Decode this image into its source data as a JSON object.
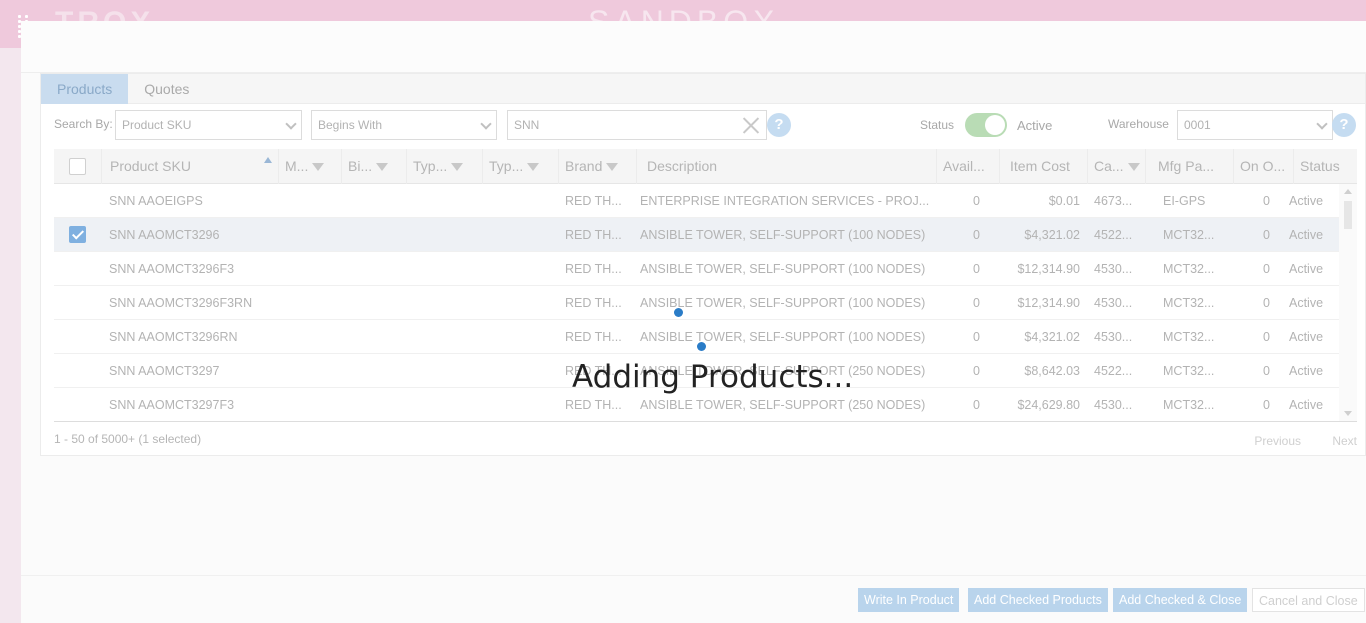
{
  "app": {
    "logo": "TROX",
    "environment": "SANDBOX"
  },
  "tabs": [
    {
      "label": "Products",
      "active": true
    },
    {
      "label": "Quotes",
      "active": false
    }
  ],
  "search": {
    "search_by_label": "Search By:",
    "search_by_value": "Product SKU",
    "match_value": "Begins With",
    "query": "SNN",
    "help": "?",
    "status_label": "Status",
    "status_value": "Active",
    "warehouse_label": "Warehouse",
    "warehouse_value": "0001"
  },
  "columns": [
    "Product SKU",
    "M...",
    "Bi...",
    "Typ...",
    "Typ...",
    "Brand",
    "Description",
    "Avail...",
    "Item Cost",
    "Ca...",
    "Mfg Pa...",
    "On O...",
    "Status"
  ],
  "rows": [
    {
      "sku": "SNN AAOEIGPS",
      "brand": "RED TH...",
      "description": "ENTERPRISE INTEGRATION SERVICES - PROJ...",
      "avail": "0",
      "cost": "$0.01",
      "cat": "4673...",
      "mfg": "EI-GPS",
      "on_order": "0",
      "status": "Active",
      "checked": false
    },
    {
      "sku": "SNN AAOMCT3296",
      "brand": "RED TH...",
      "description": "ANSIBLE TOWER, SELF-SUPPORT (100 NODES)",
      "avail": "0",
      "cost": "$4,321.02",
      "cat": "4522...",
      "mfg": "MCT32...",
      "on_order": "0",
      "status": "Active",
      "checked": true
    },
    {
      "sku": "SNN AAOMCT3296F3",
      "brand": "RED TH...",
      "description": "ANSIBLE TOWER, SELF-SUPPORT (100 NODES)",
      "avail": "0",
      "cost": "$12,314.90",
      "cat": "4530...",
      "mfg": "MCT32...",
      "on_order": "0",
      "status": "Active",
      "checked": false
    },
    {
      "sku": "SNN AAOMCT3296F3RN",
      "brand": "RED TH...",
      "description": "ANSIBLE TOWER, SELF-SUPPORT (100 NODES)",
      "avail": "0",
      "cost": "$12,314.90",
      "cat": "4530...",
      "mfg": "MCT32...",
      "on_order": "0",
      "status": "Active",
      "checked": false
    },
    {
      "sku": "SNN AAOMCT3296RN",
      "brand": "RED TH...",
      "description": "ANSIBLE TOWER, SELF-SUPPORT (100 NODES)",
      "avail": "0",
      "cost": "$4,321.02",
      "cat": "4530...",
      "mfg": "MCT32...",
      "on_order": "0",
      "status": "Active",
      "checked": false
    },
    {
      "sku": "SNN AAOMCT3297",
      "brand": "RED TH...",
      "description": "ANSIBLE TOWER, SELF-SUPPORT (250 NODES)",
      "avail": "0",
      "cost": "$8,642.03",
      "cat": "4522...",
      "mfg": "MCT32...",
      "on_order": "0",
      "status": "Active",
      "checked": false
    },
    {
      "sku": "SNN AAOMCT3297F3",
      "brand": "RED TH...",
      "description": "ANSIBLE TOWER, SELF-SUPPORT (250 NODES)",
      "avail": "0",
      "cost": "$24,629.80",
      "cat": "4530...",
      "mfg": "MCT32...",
      "on_order": "0",
      "status": "Active",
      "checked": false
    }
  ],
  "pager": {
    "summary": "1 - 50 of 5000+ (1 selected)",
    "previous": "Previous",
    "next": "Next"
  },
  "loading": {
    "text": "Adding Products..."
  },
  "footer": {
    "write_in": "Write In Product",
    "add_checked": "Add Checked Products",
    "add_close": "Add Checked & Close",
    "cancel": "Cancel and Close"
  },
  "colors": {
    "accent": "#7fb0e0",
    "toggle_on": "#b9dcb5",
    "spinner": "#2a7cc7"
  }
}
